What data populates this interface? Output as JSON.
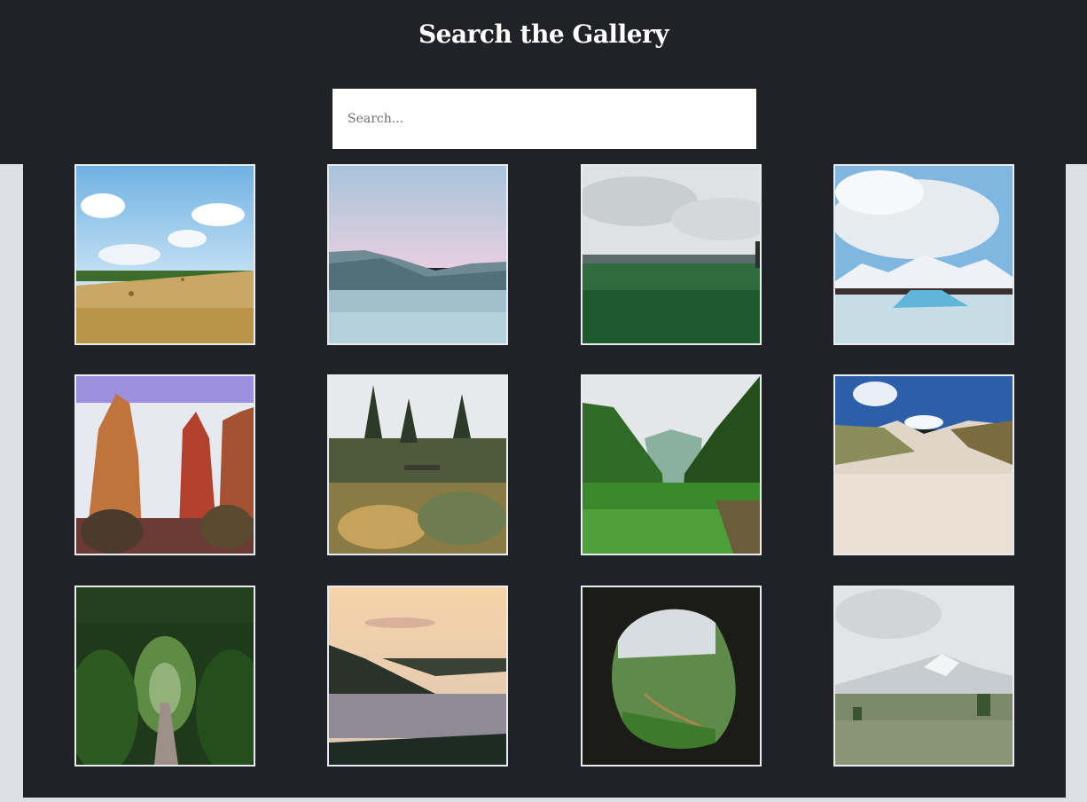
{
  "header": {
    "title": "Search the Gallery"
  },
  "search": {
    "placeholder": "Search...",
    "value": ""
  },
  "gallery": {
    "images": [
      {
        "subject": "golden hay field with round bales under blue sky"
      },
      {
        "subject": "calm pale lake with misty mountains"
      },
      {
        "subject": "green grassland under overcast sky"
      },
      {
        "subject": "glacier lagoon with blue icebergs"
      },
      {
        "subject": "red sandstone canyon cliffs"
      },
      {
        "subject": "garden with monkey puzzle trees"
      },
      {
        "subject": "lush green valley with rice terraces"
      },
      {
        "subject": "sand dunes with grass under blue sky"
      },
      {
        "subject": "tree tunnel with dirt path"
      },
      {
        "subject": "coastal cliffs at sunset"
      },
      {
        "subject": "view from cave over green valley"
      },
      {
        "subject": "snowy mountain behind lupine field"
      }
    ]
  }
}
